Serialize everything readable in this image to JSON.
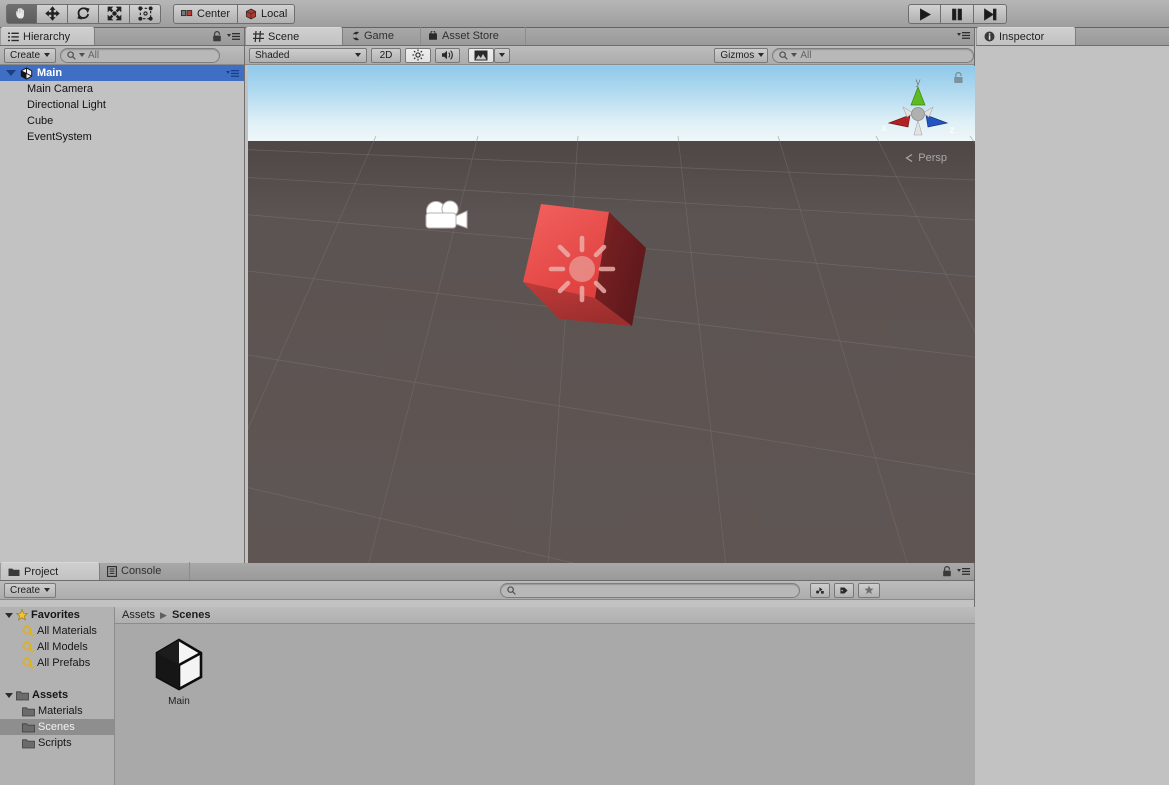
{
  "toolbar": {
    "tools": [
      {
        "name": "hand-tool",
        "icon": "hand-icon",
        "active": true
      },
      {
        "name": "move-tool",
        "icon": "move-icon",
        "active": false
      },
      {
        "name": "rotate-tool",
        "icon": "rotate-icon",
        "active": false
      },
      {
        "name": "scale-tool",
        "icon": "scale-icon",
        "active": false
      },
      {
        "name": "rect-tool",
        "icon": "rect-transform-icon",
        "active": false
      }
    ],
    "pivot_label": "Center",
    "rotation_label": "Local",
    "play_label": "▶",
    "pause_label": "‖",
    "step_label": "▶|"
  },
  "hierarchy": {
    "tab": "Hierarchy",
    "create_label": "Create",
    "search_placeholder": "All",
    "items": [
      {
        "label": "Main",
        "depth": 0,
        "selected": true,
        "icon": "unity-scene-icon",
        "expanded": true
      },
      {
        "label": "Main Camera",
        "depth": 1,
        "selected": false
      },
      {
        "label": "Directional Light",
        "depth": 1,
        "selected": false
      },
      {
        "label": "Cube",
        "depth": 1,
        "selected": false
      },
      {
        "label": "EventSystem",
        "depth": 1,
        "selected": false
      }
    ]
  },
  "scene": {
    "tabs": [
      {
        "label": "Scene",
        "icon": "grid-icon",
        "active": true
      },
      {
        "label": "Game",
        "icon": "gamepad-icon",
        "active": false
      },
      {
        "label": "Asset Store",
        "icon": "store-icon",
        "active": false
      }
    ],
    "draw_mode": "Shaded",
    "toggle_2d": "2D",
    "gizmos_label": "Gizmos",
    "search_placeholder": "All",
    "perspective_label": "Persp",
    "axis_x": "x",
    "axis_y": "y",
    "axis_z": "z",
    "colors": {
      "sky_top": "#8fc9ea",
      "sky_horizon": "#f0f7f8",
      "ground": "#5a5250",
      "cube_front": "#f0514f",
      "cube_side": "#6e1f21",
      "axis_x_color": "#b32222",
      "axis_y_color": "#5dbb20",
      "axis_z_color": "#2255c2"
    }
  },
  "project": {
    "tabs": [
      {
        "label": "Project",
        "icon": "folder-icon",
        "active": true
      },
      {
        "label": "Console",
        "icon": "console-icon",
        "active": false
      }
    ],
    "create_label": "Create",
    "search_placeholder": "",
    "tree": [
      {
        "label": "Favorites",
        "type": "root",
        "icon": "star-icon",
        "bold": true,
        "selected": false
      },
      {
        "label": "All Materials",
        "type": "search",
        "icon": "magnifier-icon",
        "selected": false
      },
      {
        "label": "All Models",
        "type": "search",
        "icon": "magnifier-icon",
        "selected": false
      },
      {
        "label": "All Prefabs",
        "type": "search",
        "icon": "magnifier-icon",
        "selected": false
      },
      {
        "label": "Assets",
        "type": "root",
        "icon": "folder-icon",
        "bold": true,
        "selected": false
      },
      {
        "label": "Materials",
        "type": "folder",
        "icon": "folder-icon",
        "selected": false
      },
      {
        "label": "Scenes",
        "type": "folder",
        "icon": "folder-icon",
        "selected": true
      },
      {
        "label": "Scripts",
        "type": "folder",
        "icon": "folder-icon",
        "selected": false
      }
    ],
    "breadcrumb": [
      "Assets",
      "Scenes"
    ],
    "assets": [
      {
        "label": "Main",
        "icon": "unity-scene-icon"
      }
    ]
  },
  "inspector": {
    "tab": "Inspector"
  }
}
